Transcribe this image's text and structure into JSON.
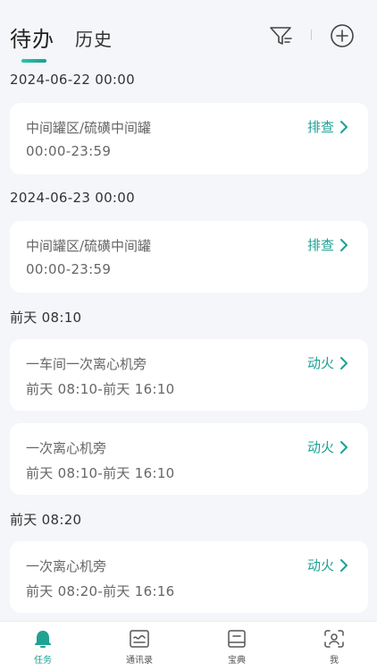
{
  "header": {
    "tab_active": "待办",
    "tab_inactive": "历史",
    "filter_icon": "filter-icon",
    "add_icon": "add-circle-icon"
  },
  "groups": [
    {
      "date": "2024-06-22 00:00",
      "cards": [
        {
          "title": "中间罐区/硫磺中间罐",
          "time": "00:00-23:59",
          "action": "排查"
        }
      ]
    },
    {
      "date": "2024-06-23 00:00",
      "cards": [
        {
          "title": "中间罐区/硫磺中间罐",
          "time": "00:00-23:59",
          "action": "排查"
        }
      ]
    },
    {
      "date": "前天 08:10",
      "cards": [
        {
          "title": "一车间一次离心机旁",
          "time": "前天 08:10-前天 16:10",
          "action": "动火"
        },
        {
          "title": "一次离心机旁",
          "time": "前天 08:10-前天 16:10",
          "action": "动火"
        }
      ]
    },
    {
      "date": "前天 08:20",
      "cards": [
        {
          "title": "一次离心机旁",
          "time": "前天 08:20-前天 16:16",
          "action": "动火"
        }
      ]
    }
  ],
  "tabbar": {
    "items": [
      {
        "label": "任务",
        "icon": "bell-icon"
      },
      {
        "label": "通讯录",
        "icon": "contacts-icon"
      },
      {
        "label": "宝典",
        "icon": "book-icon"
      },
      {
        "label": "我",
        "icon": "user-scan-icon"
      }
    ]
  },
  "colors": {
    "accent": "#1fa193",
    "background": "#f4f6f9"
  }
}
